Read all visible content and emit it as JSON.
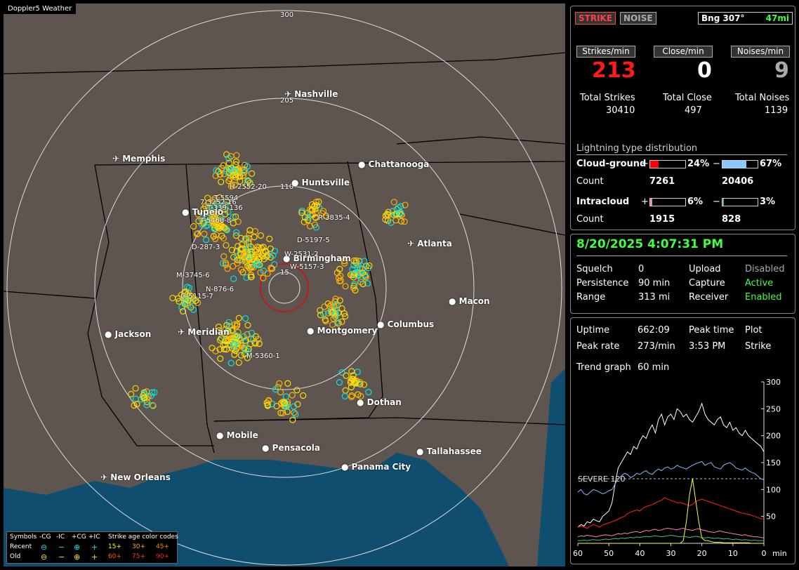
{
  "map": {
    "title": "Doppler5 Weather",
    "range_rings": [
      "300",
      "205",
      "110",
      "15"
    ],
    "cities": [
      {
        "name": "Nashville",
        "airport": true
      },
      {
        "name": "Memphis",
        "airport": true
      },
      {
        "name": "Chattanooga",
        "airport": false
      },
      {
        "name": "Huntsville",
        "airport": false
      },
      {
        "name": "Tupelo",
        "airport": false
      },
      {
        "name": "Atlanta",
        "airport": true
      },
      {
        "name": "Birmingham",
        "airport": false
      },
      {
        "name": "Macon",
        "airport": false
      },
      {
        "name": "Jackson",
        "airport": false
      },
      {
        "name": "Meridian",
        "airport": true
      },
      {
        "name": "Montgomery",
        "airport": false
      },
      {
        "name": "Columbus",
        "airport": false
      },
      {
        "name": "Dothan",
        "airport": false
      },
      {
        "name": "Mobile",
        "airport": false
      },
      {
        "name": "Pensacola",
        "airport": false
      },
      {
        "name": "Tallahassee",
        "airport": false
      },
      {
        "name": "Panama City",
        "airport": false
      },
      {
        "name": "New Orleans",
        "airport": true
      }
    ],
    "storm_tags": [
      "H-2552-20",
      "T-5594",
      "7-3252-16",
      "T-339-136",
      "T-5468-8",
      "R-3835-4",
      "D-5197-5",
      "D-287-3",
      "W-2531-2",
      "W-5157-3",
      "M-3745-6",
      "N-876-6",
      "G-5115-7",
      "M-5360-1"
    ],
    "legend": {
      "row0": [
        "Symbols",
        "-CG",
        "-IC",
        "+CG",
        "+IC",
        "Strike age color codes"
      ],
      "recent_label": "Recent",
      "old_label": "Old",
      "recent_ages": [
        "15+",
        "30+",
        "45+"
      ],
      "old_ages": [
        "60+",
        "75+",
        "90+"
      ],
      "glyph_minus": "⊖",
      "glyph_dash": "−",
      "glyph_plus": "⊕",
      "glyph_cross": "+",
      "colors": {
        "cg_recent": "#00e5e5",
        "cg_old": "#ffe000",
        "age15": "#ffff00",
        "age30": "#ffb000",
        "age45": "#ff8000",
        "age60": "#ff6000",
        "age75": "#ff4000",
        "age90": "#ff2000"
      }
    }
  },
  "status": {
    "strike_btn": "STRIKE",
    "noise_btn": "NOISE",
    "bearing_label": "Bng 307°",
    "bearing_dist": "47mi",
    "strikes_min_label": "Strikes/min",
    "close_min_label": "Close/min",
    "noises_min_label": "Noises/min",
    "strikes_min": "213",
    "close_min": "0",
    "noises_min": "9",
    "total_strikes_label": "Total Strikes",
    "total_close_label": "Total Close",
    "total_noises_label": "Total Noises",
    "total_strikes": "30410",
    "total_close": "497",
    "total_noises": "1139",
    "dist_title": "Lightning type distribution",
    "cg_label": "Cloud-ground",
    "ic_label": "Intracloud",
    "count_label": "Count",
    "plus": "+",
    "minus": "−",
    "cg_plus_pct": "24%",
    "cg_minus_pct": "67%",
    "cg_plus_count": "7261",
    "cg_minus_count": "20406",
    "ic_plus_pct": "6%",
    "ic_minus_pct": "3%",
    "ic_plus_count": "1915",
    "ic_minus_count": "828",
    "cg_plus_frac": 0.24,
    "cg_minus_frac": 0.67,
    "ic_plus_frac": 0.06,
    "ic_minus_frac": 0.03,
    "colors": {
      "cg_plus": "#ff0000",
      "cg_minus": "#88c8ff",
      "ic_plus": "#ff80c0",
      "ic_minus": "#40c080"
    }
  },
  "settings": {
    "datetime": "8/20/2025 4:07:31 PM",
    "squelch_label": "Squelch",
    "squelch": "0",
    "persistence_label": "Persistence",
    "persistence": "90 min",
    "range_label": "Range",
    "range": "313 mi",
    "upload_label": "Upload",
    "upload": "Disabled",
    "capture_label": "Capture",
    "capture": "Active",
    "receiver_label": "Receiver",
    "receiver": "Enabled"
  },
  "stats": {
    "uptime_label": "Uptime",
    "uptime": "662:09",
    "peak_time_label": "Peak time",
    "peak_time": "3:53 PM",
    "plot_label": "Plot",
    "plot": "Strike",
    "peak_rate_label": "Peak rate",
    "peak_rate": "273/min",
    "trend_label": "Trend graph",
    "trend": "60 min"
  },
  "chart_data": {
    "type": "line",
    "title": "",
    "xlabel": "min",
    "ylabel": "",
    "x_ticks": [
      "60",
      "50",
      "40",
      "30",
      "20",
      "10",
      "0"
    ],
    "y_ticks": [
      "300",
      "250",
      "200",
      "150",
      "100",
      "50"
    ],
    "ylim": [
      0,
      300
    ],
    "xlim": [
      60,
      0
    ],
    "threshold": {
      "label": "SEVERE 120",
      "value": 120
    },
    "grid": false,
    "series": [
      {
        "color": "#ffffff",
        "values": [
          30,
          35,
          32,
          40,
          38,
          45,
          42,
          40,
          50,
          55,
          60,
          75,
          110,
          140,
          150,
          160,
          170,
          165,
          180,
          175,
          190,
          200,
          195,
          210,
          220,
          205,
          230,
          240,
          220,
          235,
          240,
          230,
          250,
          245,
          235,
          240,
          230,
          225,
          235,
          245,
          260,
          240,
          230,
          225,
          220,
          230,
          235,
          220,
          215,
          225,
          210,
          215,
          205,
          200,
          210,
          200,
          195,
          190,
          185,
          180,
          170
        ]
      },
      {
        "color": "#88b8ff",
        "values": [
          95,
          100,
          92,
          90,
          95,
          100,
          98,
          95,
          92,
          94,
          98,
          100,
          110,
          120,
          125,
          130,
          128,
          122,
          125,
          130,
          128,
          132,
          135,
          130,
          128,
          134,
          138,
          135,
          140,
          142,
          138,
          140,
          145,
          142,
          140,
          138,
          142,
          145,
          148,
          150,
          152,
          145,
          148,
          150,
          142,
          140,
          138,
          145,
          148,
          150,
          146,
          140,
          138,
          136,
          140,
          135,
          132,
          130,
          125,
          120,
          118
        ]
      },
      {
        "color": "#ff2020",
        "values": [
          30,
          32,
          30,
          28,
          32,
          35,
          33,
          30,
          34,
          36,
          38,
          40,
          42,
          45,
          48,
          50,
          55,
          58,
          60,
          62,
          60,
          65,
          68,
          70,
          72,
          75,
          78,
          80,
          85,
          82,
          80,
          78,
          75,
          76,
          74,
          72,
          70,
          72,
          78,
          80,
          82,
          80,
          78,
          76,
          74,
          72,
          70,
          68,
          66,
          64,
          62,
          60,
          58,
          56,
          55,
          54,
          52,
          50,
          48,
          46,
          45
        ]
      },
      {
        "color": "#ffff30",
        "values": [
          0,
          0,
          0,
          0,
          0,
          0,
          0,
          0,
          0,
          0,
          0,
          0,
          0,
          0,
          0,
          0,
          0,
          0,
          0,
          0,
          0,
          0,
          0,
          0,
          0,
          0,
          0,
          0,
          0,
          0,
          0,
          0,
          0,
          0,
          5,
          40,
          90,
          120,
          80,
          40,
          10,
          5,
          5,
          3,
          2,
          2,
          2,
          1,
          1,
          1,
          1,
          1,
          1,
          1,
          1,
          1,
          0,
          0,
          0,
          0,
          0
        ]
      },
      {
        "color": "#ff80c0",
        "values": [
          12,
          14,
          13,
          15,
          14,
          13,
          12,
          14,
          15,
          16,
          15,
          14,
          16,
          18,
          17,
          19,
          18,
          20,
          21,
          22,
          20,
          22,
          24,
          23,
          25,
          26,
          24,
          25,
          27,
          28,
          27,
          26,
          25,
          27,
          28,
          26,
          25,
          24,
          26,
          27,
          25,
          24,
          22,
          21,
          20,
          22,
          23,
          21,
          20,
          19,
          18,
          17,
          16,
          15,
          16,
          14,
          13,
          12,
          12,
          11,
          10
        ]
      },
      {
        "color": "#40c080",
        "values": [
          5,
          5,
          6,
          5,
          6,
          7,
          6,
          6,
          7,
          8,
          7,
          8,
          9,
          8,
          10,
          9,
          10,
          11,
          10,
          12,
          11,
          12,
          13,
          12,
          13,
          14,
          13,
          12,
          13,
          14,
          15,
          14,
          13,
          12,
          13,
          12,
          11,
          12,
          13,
          12,
          11,
          10,
          11,
          10,
          9,
          10,
          9,
          8,
          9,
          8,
          7,
          8,
          7,
          6,
          7,
          6,
          5,
          6,
          5,
          5,
          5
        ]
      }
    ]
  }
}
